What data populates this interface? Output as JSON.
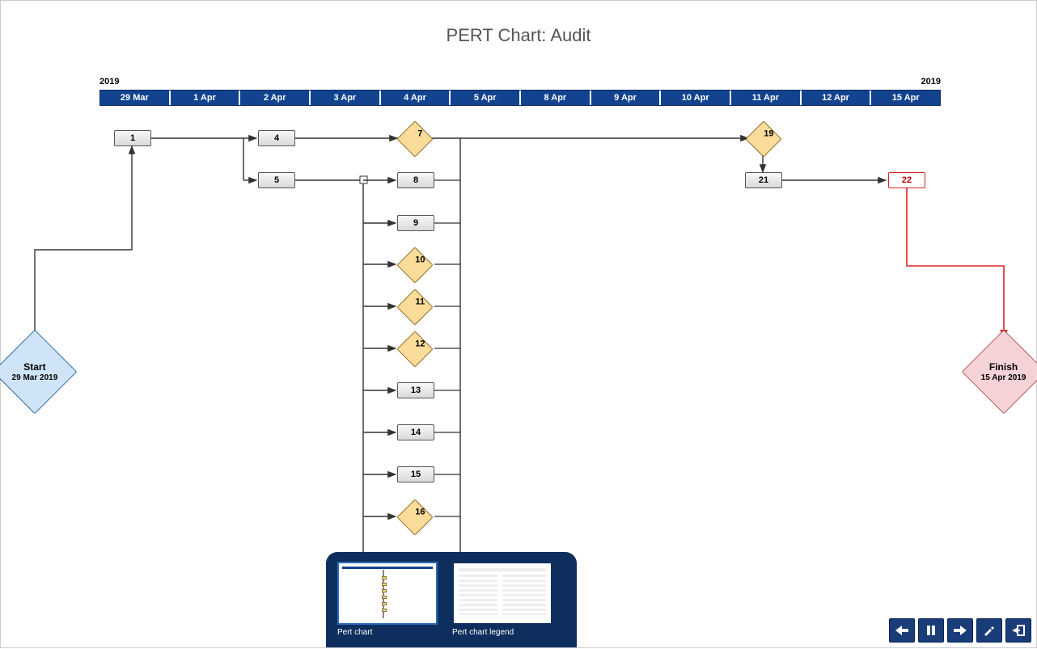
{
  "title": "PERT Chart: Audit",
  "timeline": {
    "year_left": "2019",
    "year_right": "2019",
    "cells": [
      "29 Mar",
      "1 Apr",
      "2 Apr",
      "3 Apr",
      "4 Apr",
      "5 Apr",
      "8 Apr",
      "9 Apr",
      "10 Apr",
      "11 Apr",
      "12 Apr",
      "15 Apr"
    ]
  },
  "start": {
    "label": "Start",
    "date": "29 Mar 2019"
  },
  "finish": {
    "label": "Finish",
    "date": "15 Apr 2019"
  },
  "nodes": {
    "n1": "1",
    "n4": "4",
    "n5": "5",
    "n7": "7",
    "n8": "8",
    "n9": "9",
    "n10": "10",
    "n11": "11",
    "n12": "12",
    "n13": "13",
    "n14": "14",
    "n15": "15",
    "n16": "16",
    "n19": "19",
    "n21": "21",
    "n22": "22"
  },
  "thumbnails": {
    "a": "Pert chart",
    "b": "Pert chart legend"
  },
  "chart_data": {
    "type": "pert-network",
    "title": "PERT Chart: Audit",
    "time_axis": [
      "29 Mar",
      "1 Apr",
      "2 Apr",
      "3 Apr",
      "4 Apr",
      "5 Apr",
      "8 Apr",
      "9 Apr",
      "10 Apr",
      "11 Apr",
      "12 Apr",
      "15 Apr"
    ],
    "nodes": [
      {
        "id": "start",
        "type": "start",
        "label": "Start",
        "date": "29 Mar 2019"
      },
      {
        "id": "1",
        "type": "task",
        "label": "1",
        "date": "29 Mar"
      },
      {
        "id": "4",
        "type": "task",
        "label": "4",
        "date": "2 Apr"
      },
      {
        "id": "5",
        "type": "task",
        "label": "5",
        "date": "2 Apr"
      },
      {
        "id": "7",
        "type": "milestone",
        "label": "7",
        "date": "4 Apr"
      },
      {
        "id": "8",
        "type": "task",
        "label": "8",
        "date": "4 Apr"
      },
      {
        "id": "9",
        "type": "task",
        "label": "9",
        "date": "4 Apr"
      },
      {
        "id": "10",
        "type": "milestone",
        "label": "10",
        "date": "4 Apr"
      },
      {
        "id": "11",
        "type": "milestone",
        "label": "11",
        "date": "4 Apr"
      },
      {
        "id": "12",
        "type": "milestone",
        "label": "12",
        "date": "4 Apr"
      },
      {
        "id": "13",
        "type": "task",
        "label": "13",
        "date": "4 Apr"
      },
      {
        "id": "14",
        "type": "task",
        "label": "14",
        "date": "4 Apr"
      },
      {
        "id": "15",
        "type": "task",
        "label": "15",
        "date": "4 Apr"
      },
      {
        "id": "16",
        "type": "milestone",
        "label": "16",
        "date": "4 Apr"
      },
      {
        "id": "19",
        "type": "milestone",
        "label": "19",
        "date": "11 Apr"
      },
      {
        "id": "21",
        "type": "task",
        "label": "21",
        "date": "11 Apr"
      },
      {
        "id": "22",
        "type": "critical",
        "label": "22",
        "date": "15 Apr"
      },
      {
        "id": "finish",
        "type": "finish",
        "label": "Finish",
        "date": "15 Apr 2019"
      }
    ],
    "edges": [
      {
        "from": "start",
        "to": "1"
      },
      {
        "from": "1",
        "to": "4"
      },
      {
        "from": "1",
        "to": "5"
      },
      {
        "from": "4",
        "to": "7"
      },
      {
        "from": "5",
        "to": "8"
      },
      {
        "from": "5",
        "to": "9"
      },
      {
        "from": "5",
        "to": "10"
      },
      {
        "from": "5",
        "to": "11"
      },
      {
        "from": "5",
        "to": "12"
      },
      {
        "from": "5",
        "to": "13"
      },
      {
        "from": "5",
        "to": "14"
      },
      {
        "from": "5",
        "to": "15"
      },
      {
        "from": "5",
        "to": "16"
      },
      {
        "from": "7",
        "to": "19"
      },
      {
        "from": "19",
        "to": "21"
      },
      {
        "from": "21",
        "to": "22"
      },
      {
        "from": "22",
        "to": "finish",
        "critical": true
      }
    ]
  }
}
